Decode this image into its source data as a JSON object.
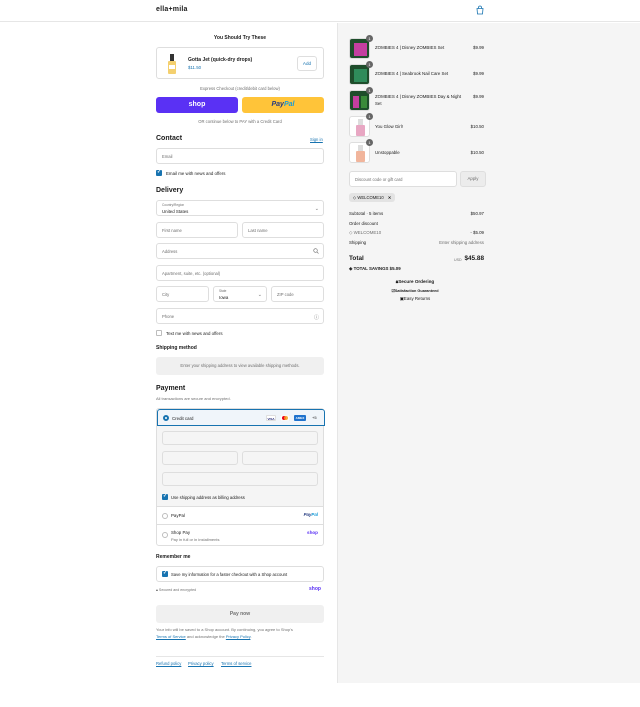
{
  "header": {
    "brand": "ella+mila"
  },
  "upsell": {
    "title": "You Should Try These",
    "product_name": "Gotta Jet (quick-dry drops)",
    "price": "$11.50",
    "add_label": "Add"
  },
  "express": {
    "label": "Express Checkout (credit/debit card below)",
    "shop_label": "shop",
    "paypal_a": "Pay",
    "paypal_b": "Pal",
    "or_label": "OR continue below to PAY with a Credit Card"
  },
  "contact": {
    "title": "Contact",
    "sign_in": "Sign in",
    "email_placeholder": "Email",
    "news_label": "Email me with news and offers"
  },
  "delivery": {
    "title": "Delivery",
    "country_label": "Country/Region",
    "country_value": "United States",
    "first_name": "First name",
    "last_name": "Last name",
    "address": "Address",
    "apartment": "Apartment, suite, etc. (optional)",
    "city": "City",
    "state_label": "State",
    "state_value": "Iowa",
    "zip": "ZIP code",
    "phone": "Phone",
    "text_me": "Text me with news and offers"
  },
  "shipping": {
    "title": "Shipping method",
    "note": "Enter your shipping address to view available shipping methods."
  },
  "payment": {
    "title": "Payment",
    "subtitle": "All transactions are secure and encrypted.",
    "credit_card": "Credit card",
    "visa": "VISA",
    "amex": "AMEX",
    "more": "+5",
    "billing_label": "Use shipping address as billing address",
    "paypal": "PayPal",
    "shop_pay": "Shop Pay",
    "shop_pay_sub": "Pay in full or in installments",
    "shop_logo": "shop"
  },
  "remember": {
    "title": "Remember me",
    "save_label": "Save my information for a faster checkout with a Shop account",
    "secure": "Secured and encrypted",
    "shop_logo": "shop"
  },
  "pay_now": "Pay now",
  "legal": {
    "line1": "Your info will be saved to a Shop account. By continuing, you agree to Shop's",
    "tos": "Terms of Service",
    "and": "and acknowledge the",
    "privacy": "Privacy Policy",
    "end": "."
  },
  "footer": {
    "refund": "Refund policy",
    "privacy": "Privacy policy",
    "terms": "Terms of service"
  },
  "cart": {
    "items": [
      {
        "name": "ZOMBIES 4 | Disney ZOMBIES Set",
        "qty": "1",
        "price": "$9.99"
      },
      {
        "name": "ZOMBIES 4 | Seabrook Nail Care Set",
        "qty": "1",
        "price": "$9.99"
      },
      {
        "name": "ZOMBIES 4 | Disney ZOMBIES Day & Night Set",
        "qty": "1",
        "price": "$9.99"
      },
      {
        "name": "You Glow Girl!",
        "qty": "1",
        "price": "$10.50"
      },
      {
        "name": "Unstoppable",
        "qty": "1",
        "price": "$10.50"
      }
    ],
    "discount_placeholder": "Discount code or gift card",
    "apply": "Apply",
    "code": "WELCOME10",
    "subtotal_label": "Subtotal · 5 items",
    "subtotal": "$50.97",
    "order_discount": "Order discount",
    "discount_code": "WELCOME10",
    "discount_value": "- $5.09",
    "shipping_label": "Shipping",
    "shipping_value": "Enter shipping address",
    "total_label": "Total",
    "currency": "USD",
    "total": "$45.88",
    "savings_label": "TOTAL SAVINGS",
    "savings": "$5.09",
    "trust1": "Secure Ordering",
    "trust2": "Satisfaction Guaranteed",
    "trust3": "Easy Returns"
  }
}
